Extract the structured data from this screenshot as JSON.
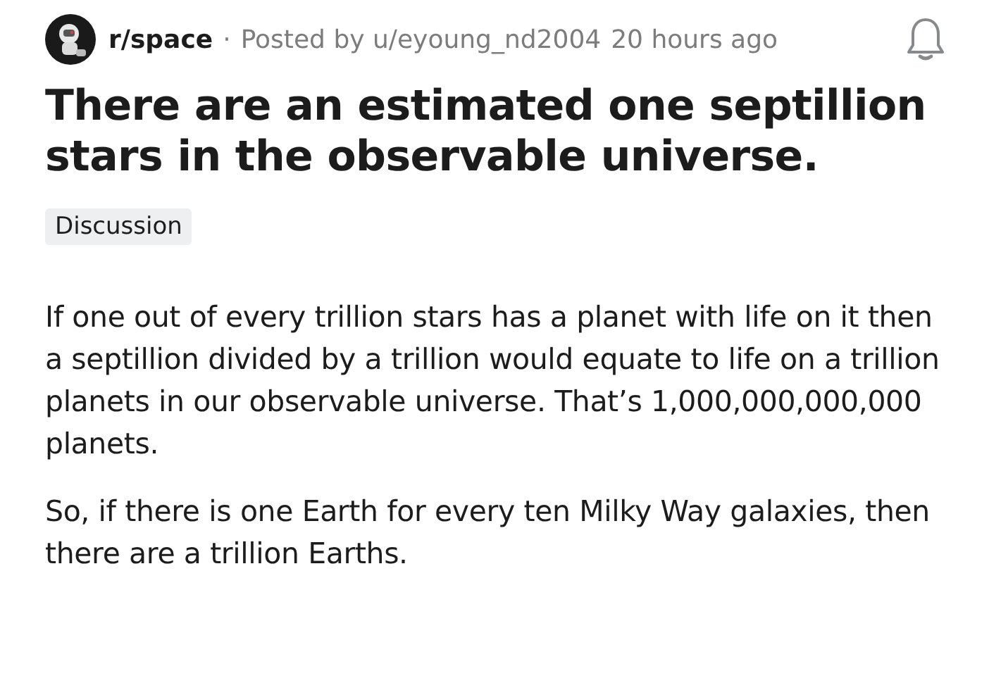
{
  "post": {
    "subreddit": "r/space",
    "separator": "·",
    "posted_by": "Posted by u/eyoung_nd2004",
    "time": "20 hours ago",
    "title": "There are an estimated one septillion stars in the observable universe.",
    "flair": "Discussion",
    "paragraphs": [
      "If one out of every trillion stars has a planet with life on it then a septillion divided by a trillion would equate to life on a trillion planets in our observable universe. That’s 1,000,000,000,000 planets.",
      "So, if there is one Earth for every ten Milky Way galaxies, then there are a trillion Earths."
    ]
  }
}
